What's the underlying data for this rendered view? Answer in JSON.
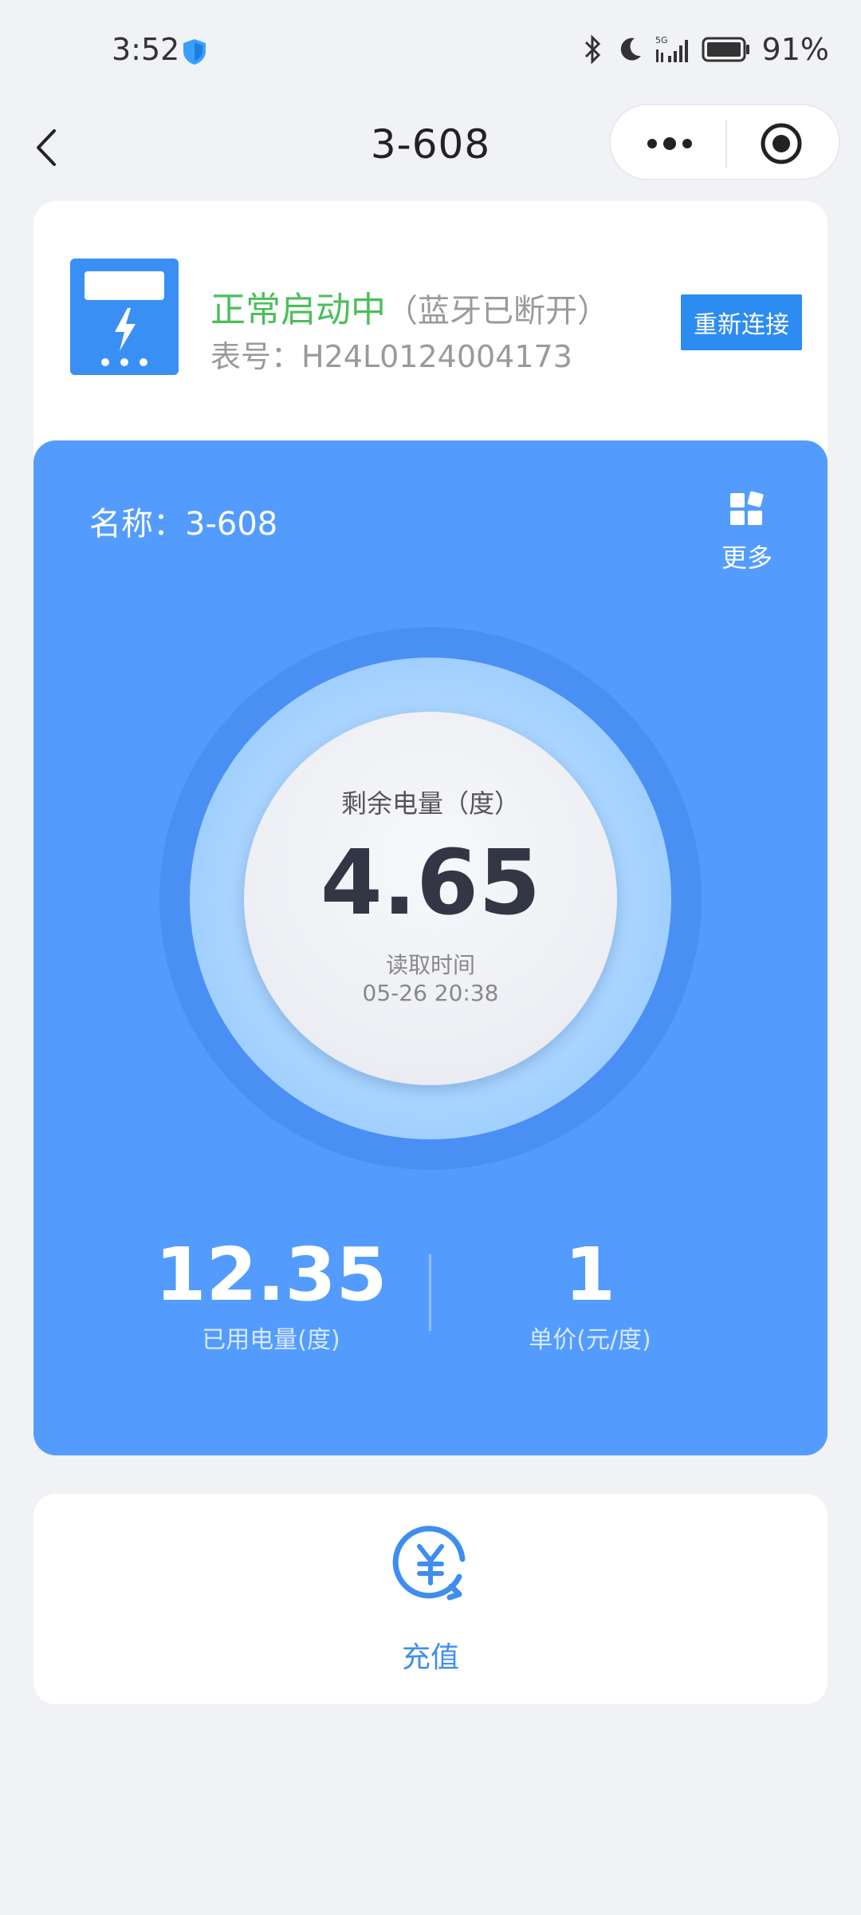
{
  "status_bar": {
    "time": "3:52",
    "battery": "91%"
  },
  "nav": {
    "title": "3-608"
  },
  "device": {
    "status": "正常启动中",
    "bluetooth_status": "（蓝牙已断开）",
    "meter_prefix": "表号：",
    "meter_number": "H24L0124004173",
    "reconnect_label": "重新连接"
  },
  "panel": {
    "name_prefix": "名称：",
    "name": "3-608",
    "more_label": "更多",
    "remaining_label": "剩余电量（度）",
    "remaining_value": "4.65",
    "read_label": "读取时间",
    "read_time": "05-26 20:38",
    "used_value": "12.35",
    "used_label": "已用电量(度)",
    "price_value": "1",
    "price_label": "单价(元/度)"
  },
  "recharge": {
    "label": "充值"
  },
  "colors": {
    "accent_blue": "#539cfd",
    "button_blue": "#2d8cf0",
    "status_green": "#4cbe5b"
  }
}
